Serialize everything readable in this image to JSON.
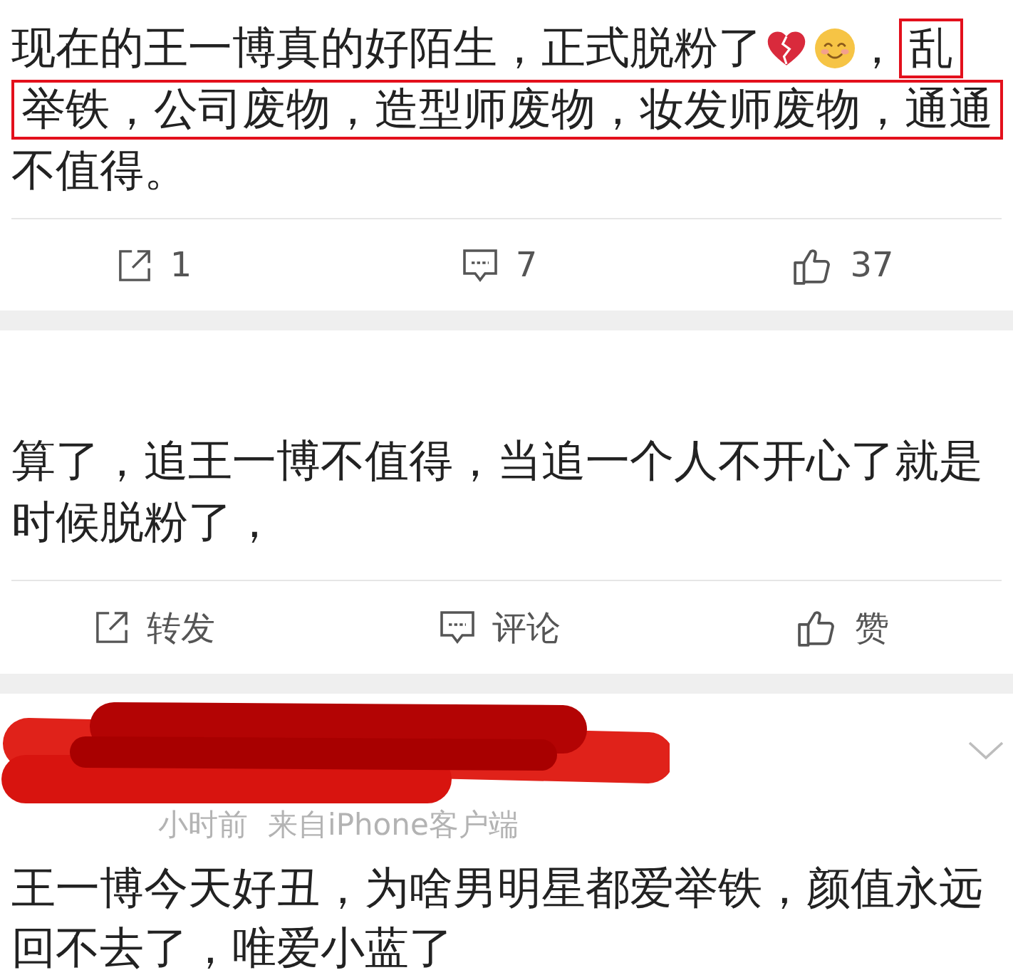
{
  "posts": [
    {
      "segments": [
        {
          "kind": "text",
          "text": "现在的王一博真的好陌生，正式脱粉了",
          "highlighted": false
        },
        {
          "kind": "broken_heart_emoji"
        },
        {
          "kind": "smile_emoji"
        },
        {
          "kind": "text",
          "text": "，",
          "highlighted": false
        },
        {
          "kind": "text",
          "text": "乱",
          "highlighted": true
        },
        {
          "kind": "text",
          "text": "举铁，公司废物，造型师废物，妆发师废物，通通",
          "highlighted": true
        },
        {
          "kind": "text",
          "text": "不值得。",
          "highlighted": false
        }
      ],
      "actions": [
        {
          "kind": "repost",
          "label": "1"
        },
        {
          "kind": "comment",
          "label": "7"
        },
        {
          "kind": "like",
          "label": "37"
        }
      ]
    },
    {
      "segments": [
        {
          "kind": "text",
          "text": "算了，追王一博不值得，当追一个人不开心了就是时候脱粉了，",
          "highlighted": false
        }
      ],
      "actions": [
        {
          "kind": "repost",
          "label": "转发"
        },
        {
          "kind": "comment",
          "label": "评论"
        },
        {
          "kind": "like",
          "label": "赞"
        }
      ]
    },
    {
      "header": {
        "redacted": true,
        "time": "小时前",
        "source": "来自iPhone客户端",
        "menu_button": true
      },
      "segments": [
        {
          "kind": "text",
          "text": "王一博今天好丑，为啥男明星都爱举铁，颜值永远回不去了，唯爱小蓝了",
          "highlighted": false
        }
      ]
    }
  ]
}
